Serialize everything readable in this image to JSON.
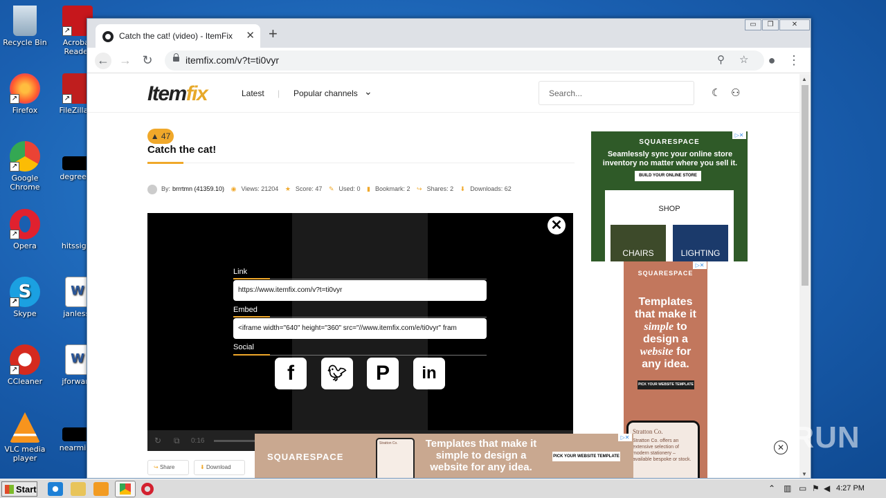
{
  "desktop": {
    "icons": [
      {
        "label": "Recycle Bin"
      },
      {
        "label": "Acrobat Reader"
      },
      {
        "label": "Firefox"
      },
      {
        "label": "FileZilla C"
      },
      {
        "label": "Google Chrome"
      },
      {
        "label": "degreeac"
      },
      {
        "label": "Opera"
      },
      {
        "label": "hitssign."
      },
      {
        "label": "Skype"
      },
      {
        "label": "janless."
      },
      {
        "label": "CCleaner"
      },
      {
        "label": "jforward"
      },
      {
        "label": "VLC media player"
      },
      {
        "label": "nearminu"
      }
    ]
  },
  "browser": {
    "tab_title": "Catch the cat! (video) - ItemFix",
    "url": "itemfix.com/v?t=ti0vyr"
  },
  "site": {
    "logo_main": "Item",
    "logo_accent": "fix",
    "nav_latest": "Latest",
    "nav_separator": "|",
    "nav_popular": "Popular channels",
    "search_placeholder": "Search..."
  },
  "video": {
    "score": "47",
    "title": "Catch the cat!",
    "meta": {
      "by_label": "By:",
      "author": "brrrtmn (41359.10)",
      "views": "Views: 21204",
      "score": "Score: 47",
      "used": "Used: 0",
      "bookmark": "Bookmark: 2",
      "shares": "Shares: 2",
      "downloads": "Downloads: 62"
    },
    "player_time": "0:16"
  },
  "share_overlay": {
    "link_label": "Link",
    "link_value": "https://www.itemfix.com/v?t=ti0vyr",
    "embed_label": "Embed",
    "embed_value": "<iframe width=\"640\" height=\"360\" src=\"//www.itemfix.com/e/ti0vyr\" fram",
    "social_label": "Social"
  },
  "actions": {
    "share": "Share",
    "download": "Download"
  },
  "ads": {
    "ad1": {
      "brand": "SQUARESPACE",
      "headline": "Seamlessly sync your online store inventory no matter where you sell it.",
      "button": "BUILD YOUR ONLINE STORE",
      "shop": "SHOP",
      "tile1": "CHAIRS",
      "tile2": "LIGHTING"
    },
    "ad2": {
      "brand": "SQUARESPACE",
      "headline_1": "Templates that make it",
      "headline_em1": "simple",
      "headline_2": "to design a",
      "headline_em2": "website",
      "headline_3": "for any idea.",
      "button": "PICK YOUR WEBSITE TEMPLATE",
      "company": "Stratton Co.",
      "desc": "Stratton Co. offers an extensive selection of modern stationery – available bespoke or stock."
    },
    "ad3": {
      "brand": "SQUARESPACE",
      "headline": "Templates that make it simple to design a website for any idea.",
      "button": "PICK YOUR WEBSITE TEMPLATE",
      "mini": "Stratton Co."
    }
  },
  "watermark": "ANY RUN",
  "taskbar": {
    "start": "Start",
    "clock": "4:27 PM"
  }
}
